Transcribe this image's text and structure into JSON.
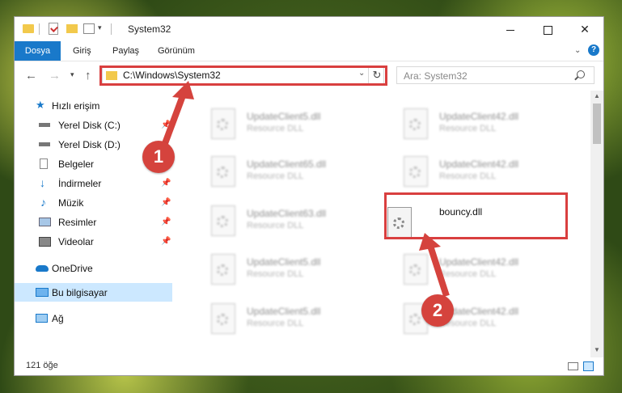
{
  "window": {
    "title": "System32",
    "controls": {
      "minimize": "",
      "maximize": "",
      "close": "✕"
    }
  },
  "ribbon": {
    "file_tab": "Dosya",
    "tabs": [
      "Giriş",
      "Paylaş",
      "Görünüm"
    ],
    "help": "?"
  },
  "nav": {
    "address": "C:\\Windows\\System32",
    "search_placeholder": "Ara: System32"
  },
  "sidebar": {
    "items": [
      {
        "label": "Hızlı erişim",
        "icon": "star-icon"
      },
      {
        "label": "Yerel Disk (C:)",
        "icon": "drive-icon",
        "pinned": true
      },
      {
        "label": "Yerel Disk (D:)",
        "icon": "drive-icon",
        "pinned": true
      },
      {
        "label": "Belgeler",
        "icon": "documents-icon",
        "pinned": true
      },
      {
        "label": "İndirmeler",
        "icon": "download-icon",
        "pinned": true
      },
      {
        "label": "Müzik",
        "icon": "music-icon",
        "pinned": true
      },
      {
        "label": "Resimler",
        "icon": "pictures-icon",
        "pinned": true
      },
      {
        "label": "Videolar",
        "icon": "videos-icon",
        "pinned": true
      },
      {
        "label": "OneDrive",
        "icon": "cloud-icon"
      },
      {
        "label": "Bu bilgisayar",
        "icon": "computer-icon",
        "selected": true
      },
      {
        "label": "Ağ",
        "icon": "network-icon"
      }
    ]
  },
  "files": [
    {
      "name": "UpdateClient5.dll",
      "type": "Resource DLL"
    },
    {
      "name": "UpdateClient42.dll",
      "type": "Resource DLL"
    },
    {
      "name": "UpdateClient65.dll",
      "type": "Resource DLL"
    },
    {
      "name": "UpdateClient42.dll",
      "type": "Resource DLL"
    },
    {
      "name": "UpdateClient63.dll",
      "type": "Resource DLL"
    },
    {
      "name": "bouncy.dll",
      "type": ""
    },
    {
      "name": "UpdateClient5.dll",
      "type": "Resource DLL"
    },
    {
      "name": "UpdateClient42.dll",
      "type": "Resource DLL"
    },
    {
      "name": "UpdateClient5.dll",
      "type": "Resource DLL"
    },
    {
      "name": "UpdateClient42.dll",
      "type": "Resource DLL"
    }
  ],
  "status": {
    "item_count": "121 öğe"
  },
  "callouts": [
    "1",
    "2"
  ],
  "colors": {
    "accent": "#1979ca",
    "highlight": "#d93f3f",
    "selected": "#cce8ff"
  }
}
